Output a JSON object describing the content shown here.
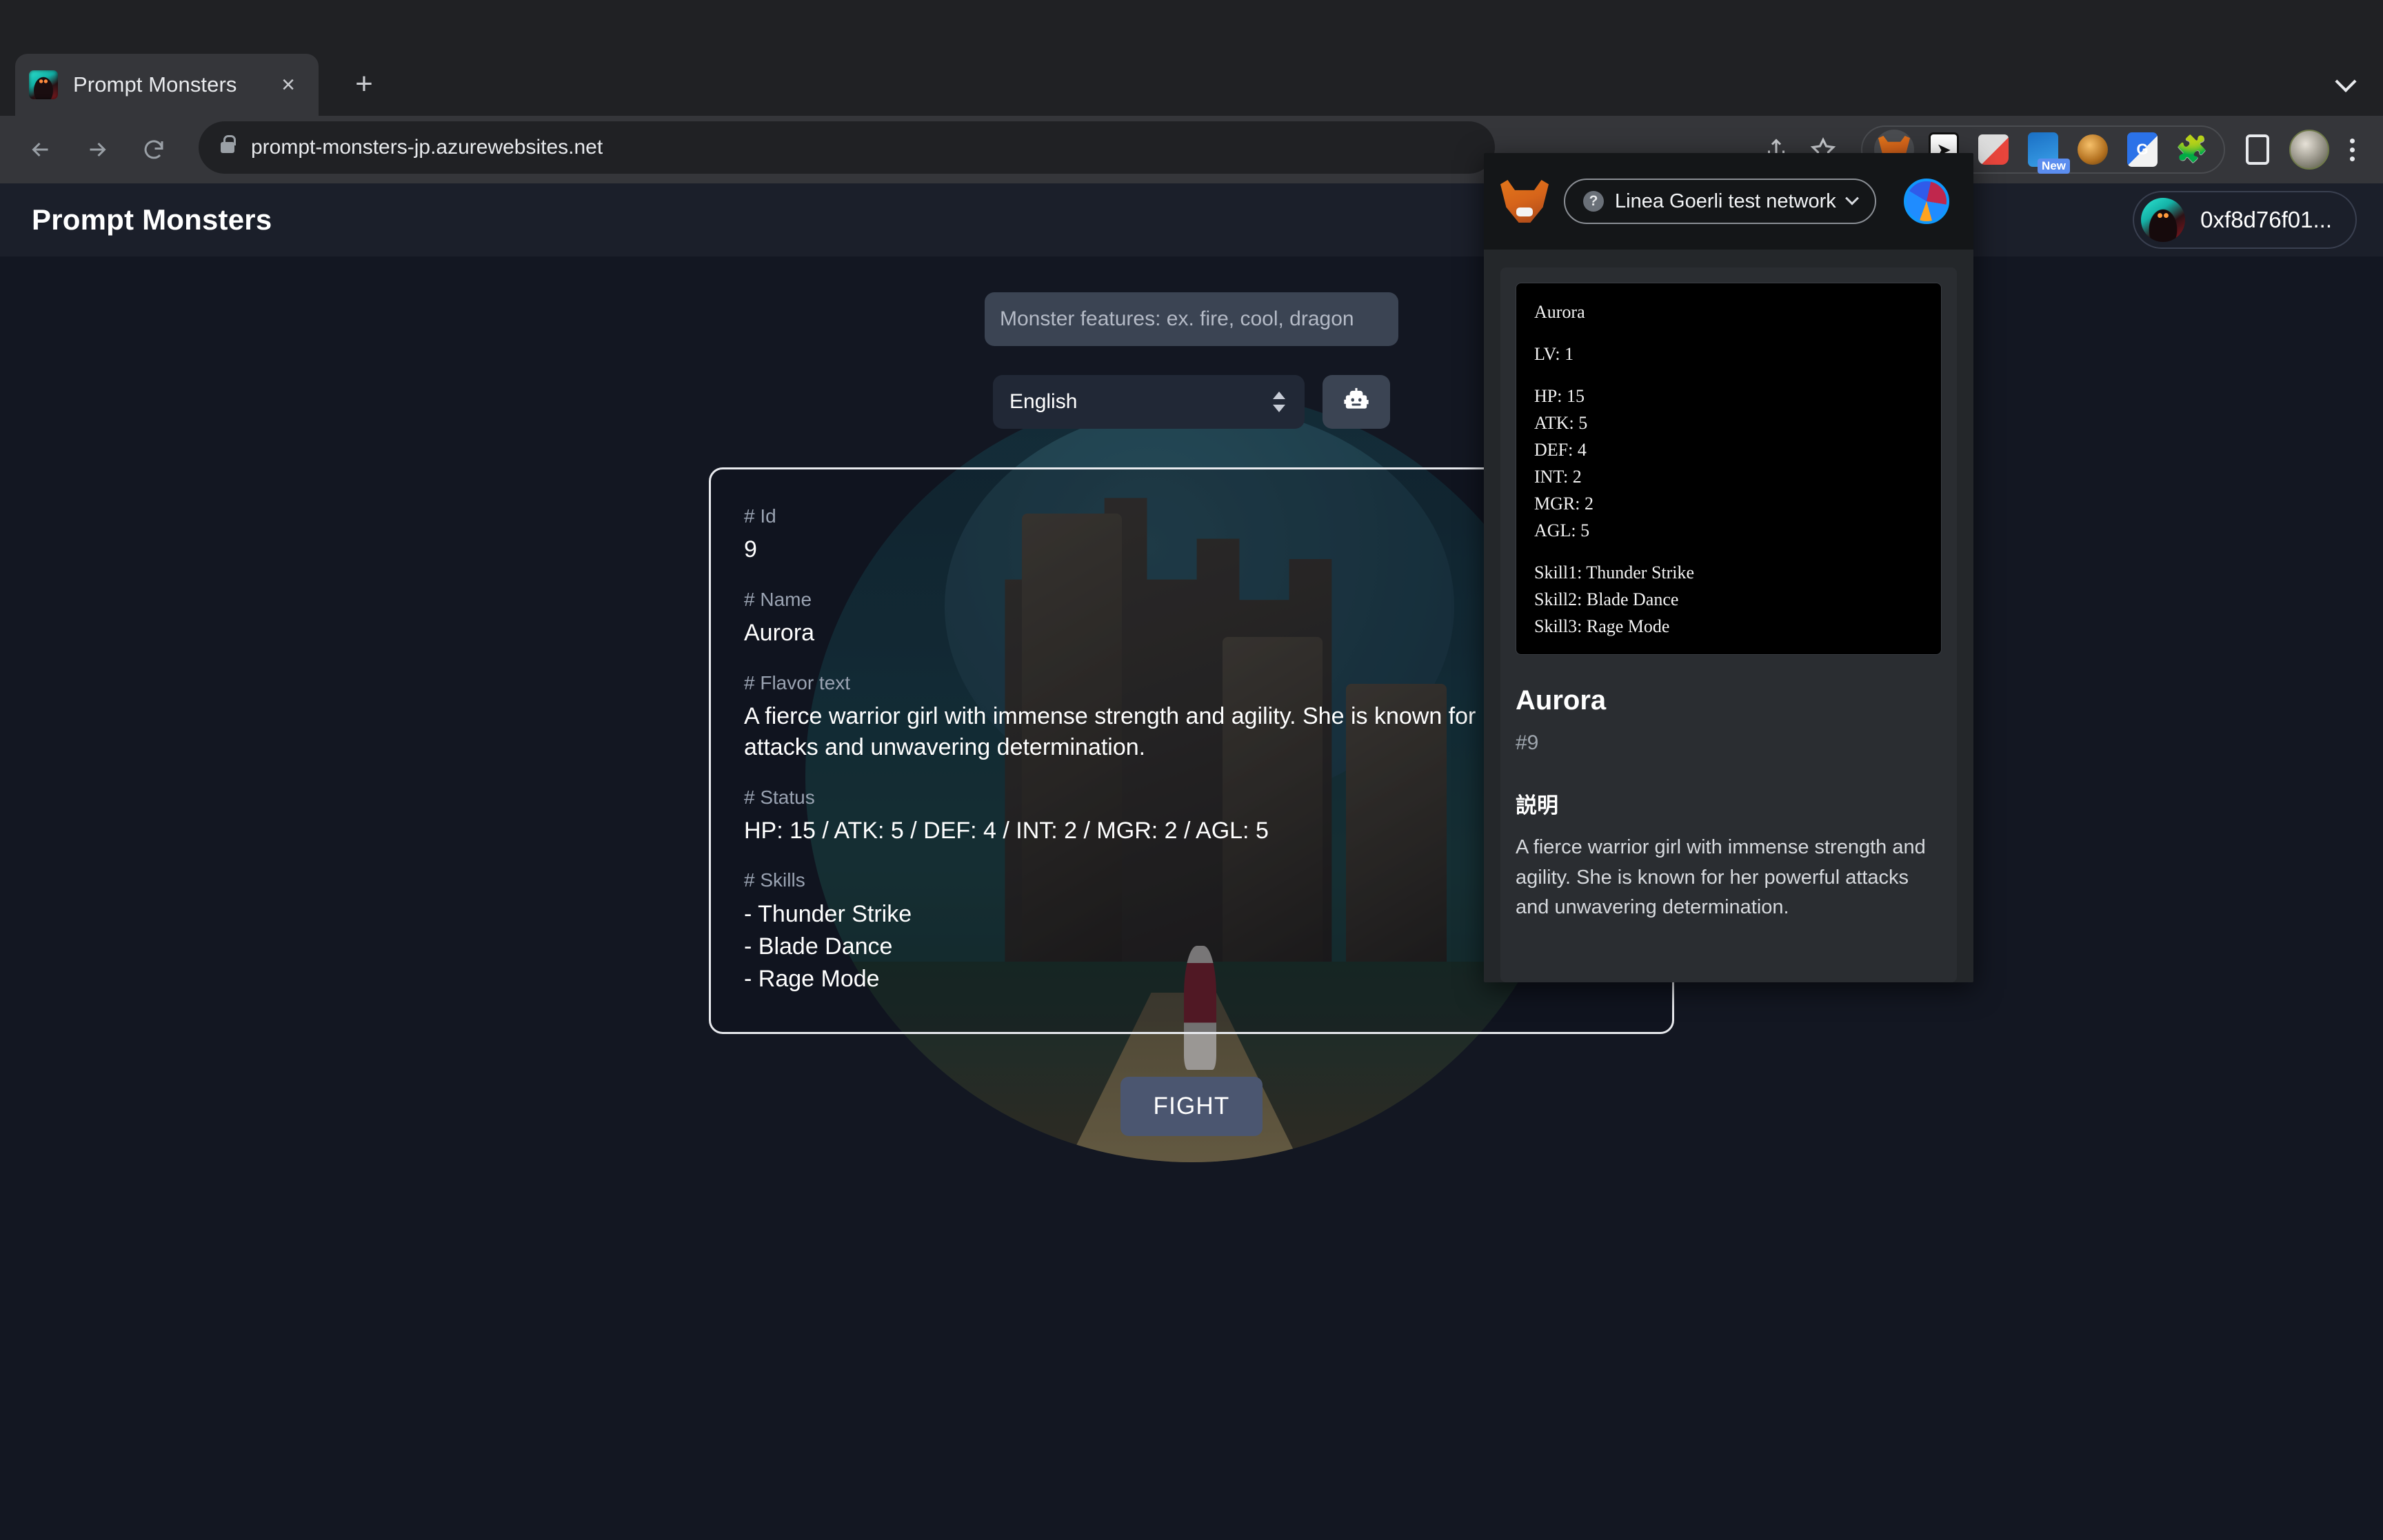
{
  "browser": {
    "tab": {
      "title": "Prompt Monsters",
      "favicon": "monster-favicon",
      "close": "×"
    },
    "new_tab_label": "+",
    "url": "prompt-monsters-jp.azurewebsites.net",
    "extensions": [
      {
        "name": "metamask-extension-icon",
        "label": ""
      },
      {
        "name": "pocket-extension-icon",
        "label": ""
      },
      {
        "name": "eyedropper-extension-icon",
        "label": ""
      },
      {
        "name": "snipping-extension-icon",
        "label": "New"
      },
      {
        "name": "hedgehog-extension-icon",
        "label": ""
      },
      {
        "name": "google-translate-extension-icon",
        "label": "G"
      },
      {
        "name": "puzzle-extensions-icon",
        "label": ""
      },
      {
        "name": "side-panel-icon",
        "label": ""
      }
    ]
  },
  "site": {
    "title": "Prompt Monsters",
    "account_address": "0xf8d76f01..."
  },
  "form": {
    "prompt_placeholder": "Monster features: ex. fire, cool, dragon",
    "prompt_value": "",
    "language_selected": "English",
    "language_options": [
      "English"
    ],
    "generate_icon": "robot-icon"
  },
  "monster": {
    "fields": [
      {
        "label": "# Id",
        "value": "9"
      },
      {
        "label": "# Name",
        "value": "Aurora"
      },
      {
        "label": "# Flavor text",
        "value": "A fierce warrior girl with immense strength and agility. She is known for her powerful attacks and unwavering determination."
      },
      {
        "label": "# Status",
        "value": "HP: 15 / ATK: 5 / DEF: 4 / INT: 2 / MGR: 2 / AGL: 5"
      }
    ],
    "skills_label": "# Skills",
    "skills": [
      "- Thunder Strike",
      "- Blade Dance",
      "- Rage Mode"
    ],
    "fight_button": "FIGHT"
  },
  "metamask": {
    "network": "Linea Goerli test network",
    "network_help_icon": "?",
    "nft_card": {
      "name": "Aurora",
      "level": "LV: 1",
      "stats": [
        "HP: 15",
        "ATK: 5",
        "DEF: 4",
        "INT: 2",
        "MGR: 2",
        "AGL: 5"
      ],
      "skills": [
        "Skill1: Thunder Strike",
        "Skill2: Blade Dance",
        "Skill3: Rage Mode"
      ]
    },
    "nft_title": "Aurora",
    "nft_id": "#9",
    "description_heading": "説明",
    "description": "A fierce warrior girl with immense strength and agility. She is known for her powerful attacks and unwavering determination."
  }
}
